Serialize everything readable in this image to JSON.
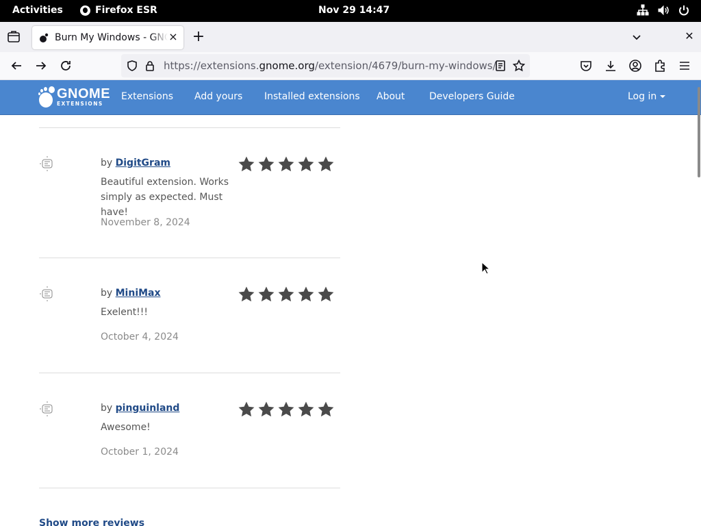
{
  "topbar": {
    "activities": "Activities",
    "app_name": "Firefox ESR",
    "clock": "Nov 29  14:47",
    "tray_icons": [
      "network-icon",
      "volume-icon",
      "power-icon"
    ]
  },
  "browser": {
    "tab_title": "Burn My Windows - GNOME Shell Extensions",
    "url_prefix": "https://extensions.",
    "url_domain": "gnome.org",
    "url_path": "/extension/4679/burn-my-windows/"
  },
  "site": {
    "logo_big": "GNOME",
    "logo_small": "EXTENSIONS",
    "nav": [
      "Extensions",
      "Add yours",
      "Installed extensions",
      "About",
      "Developers Guide"
    ],
    "login": "Log in",
    "colors": {
      "header": "#4a86cf",
      "link": "#204a87",
      "star": "#4a4a4a"
    }
  },
  "reviews": [
    {
      "by": "by ",
      "author": "DigitGram",
      "comment": "Beautiful extension. Works simply as expected. Must have!",
      "date": "November 8, 2024",
      "rating": 5
    },
    {
      "by": "by ",
      "author": "MiniMax",
      "comment": "Exelent!!!",
      "date": "October 4, 2024",
      "rating": 5
    },
    {
      "by": "by ",
      "author": "pinguinland",
      "comment": "Awesome!",
      "date": "October 1, 2024",
      "rating": 5
    }
  ],
  "show_more": "Show more reviews"
}
